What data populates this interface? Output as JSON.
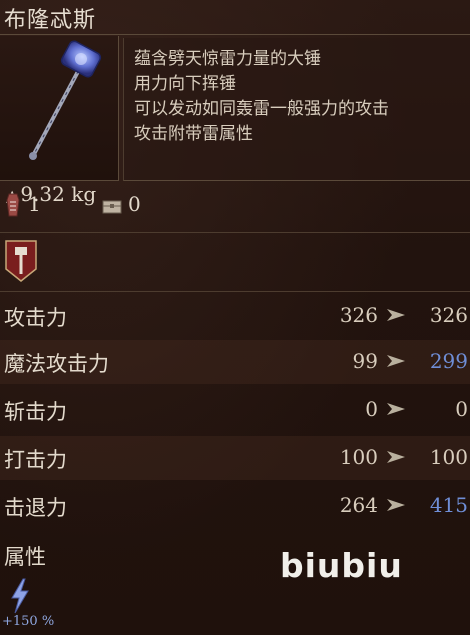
{
  "item": {
    "name": "布隆忒斯",
    "weight": "9.32 kg",
    "description": [
      "蕴含劈天惊雷力量的大锤",
      "用力向下挥锤",
      "可以发动如同轰雷一般强力的攻击",
      "攻击附带雷属性"
    ],
    "count_owned": "1",
    "count_storage": "1",
    "count_chest": "0"
  },
  "stats": [
    {
      "name": "攻击力",
      "base": "326",
      "new": "326",
      "improved": false
    },
    {
      "name": "魔法攻击力",
      "base": "99",
      "new": "299",
      "improved": true
    },
    {
      "name": "斩击力",
      "base": "0",
      "new": "0",
      "improved": false
    },
    {
      "name": "打击力",
      "base": "100",
      "new": "100",
      "improved": false
    },
    {
      "name": "击退力",
      "base": "264",
      "new": "415",
      "improved": true
    }
  ],
  "attribute": {
    "title": "属性",
    "element_icon": "lightning-icon",
    "value": "+150 %"
  },
  "watermark": "biubiu",
  "colors": {
    "improved": "#6f8ed6",
    "background": "#24140f"
  }
}
